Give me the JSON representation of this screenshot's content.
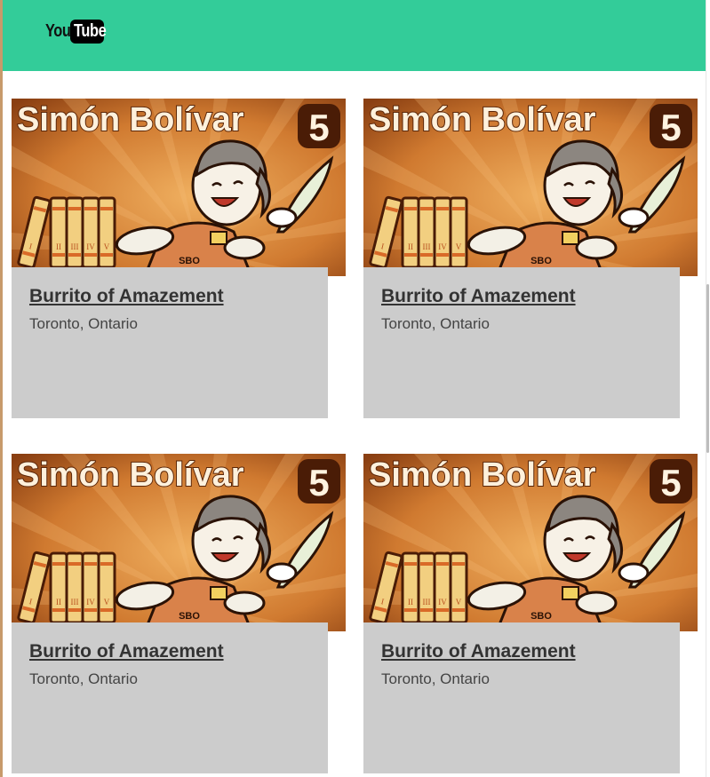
{
  "header": {
    "logo": {
      "part1": "You",
      "part2": "Tube"
    },
    "accent_color": "#33cc99"
  },
  "cards": [
    {
      "title": "Burrito of Amazement",
      "location": "Toronto, Ontario",
      "thumbnail": {
        "heading": "Simón Bolívar",
        "episode": "5",
        "initials": "SBO",
        "volumes": [
          "I",
          "II",
          "III",
          "IV",
          "V"
        ]
      }
    },
    {
      "title": "Burrito of Amazement",
      "location": "Toronto, Ontario",
      "thumbnail": {
        "heading": "Simón Bolívar",
        "episode": "5",
        "initials": "SBO",
        "volumes": [
          "I",
          "II",
          "III",
          "IV",
          "V"
        ]
      }
    },
    {
      "title": "Burrito of Amazement",
      "location": "Toronto, Ontario",
      "thumbnail": {
        "heading": "Simón Bolívar",
        "episode": "5",
        "initials": "SBO",
        "volumes": [
          "I",
          "II",
          "III",
          "IV",
          "V"
        ]
      }
    },
    {
      "title": "Burrito of Amazement",
      "location": "Toronto, Ontario",
      "thumbnail": {
        "heading": "Simón Bolívar",
        "episode": "5",
        "initials": "SBO",
        "volumes": [
          "I",
          "II",
          "III",
          "IV",
          "V"
        ]
      }
    }
  ]
}
